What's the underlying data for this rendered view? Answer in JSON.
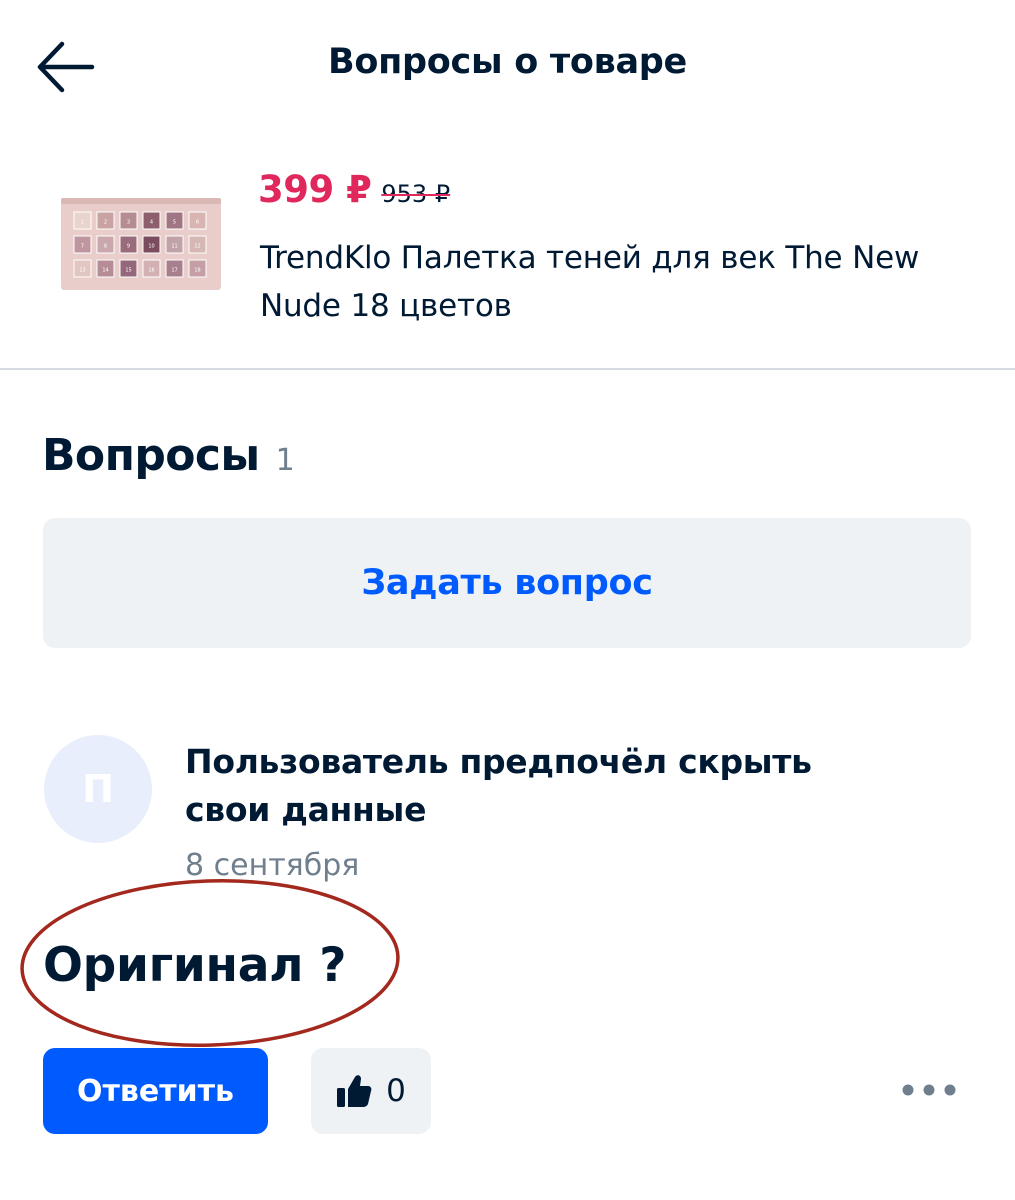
{
  "header": {
    "title": "Вопросы о товаре",
    "back_icon": "arrow-left-icon"
  },
  "product": {
    "price_new": "399 ₽",
    "price_old": "953 ₽",
    "name": "TrendKlo Палетка теней для век The New Nude 18 цветов",
    "swatch_labels": [
      "1",
      "2",
      "3",
      "4",
      "5",
      "6",
      "7",
      "8",
      "9",
      "10",
      "11",
      "12",
      "13",
      "14",
      "15",
      "16",
      "17",
      "18"
    ]
  },
  "questions": {
    "title": "Вопросы",
    "count": "1",
    "ask_button": "Задать вопрос"
  },
  "question_item": {
    "avatar_letter": "П",
    "author": "Пользователь предпочёл скрыть свои данные",
    "date": "8 сентября",
    "text": "Оригинал ?",
    "reply_button": "Ответить",
    "like_icon": "thumbs-up-icon",
    "like_count": "0",
    "more_icon": "more-dots-icon"
  },
  "colors": {
    "accent_blue": "#005bff",
    "price_red": "#e0285c",
    "text_primary": "#001a34",
    "text_secondary": "#707f8d",
    "surface_gray": "#eff2f5",
    "annotation_red": "#a3281d"
  }
}
